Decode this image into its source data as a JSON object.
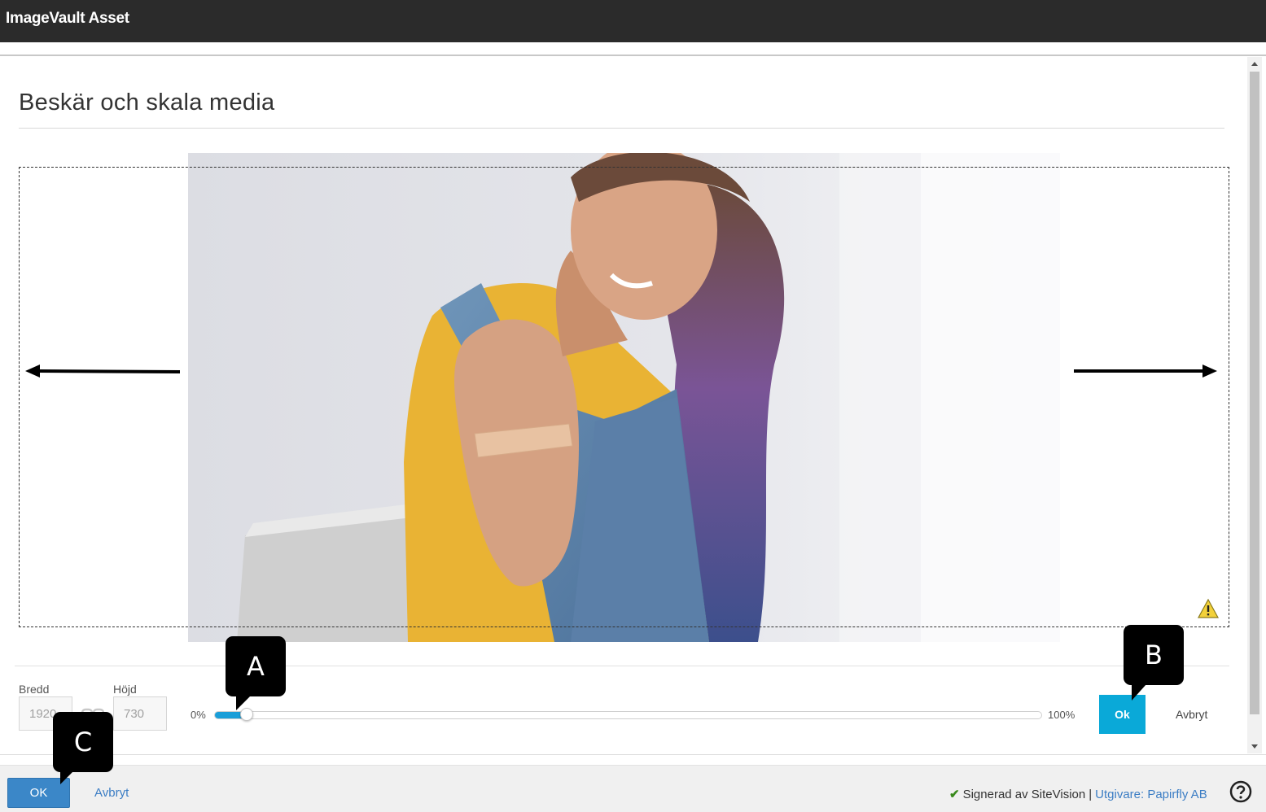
{
  "window": {
    "title": "ImageVault Asset"
  },
  "page": {
    "heading": "Beskär och skala media"
  },
  "crop": {
    "width_label": "Bredd",
    "width_value": "1920",
    "height_label": "Höjd",
    "height_value": "730",
    "slider_min_label": "0%",
    "slider_max_label": "100%",
    "slider_value_percent": 2,
    "ok_label": "Ok",
    "cancel_label": "Avbryt"
  },
  "callouts": {
    "a": "A",
    "b": "B",
    "c": "C"
  },
  "footer": {
    "ok_label": "OK",
    "cancel_label": "Avbryt",
    "signed_text": "Signerad av SiteVision",
    "separator": "|",
    "publisher_text": "Utgivare: Papirfly AB"
  },
  "colors": {
    "titlebar": "#2b2b2b",
    "accent_crop_ok": "#0aa9d8",
    "accent_main_ok": "#3b87c8",
    "link": "#3b7dc4",
    "slider_fill": "#1a9ed8"
  },
  "icons": {
    "warning": "warning-icon",
    "help": "help-icon",
    "check": "check-icon",
    "ratio_lock": "link-ratio-icon"
  }
}
